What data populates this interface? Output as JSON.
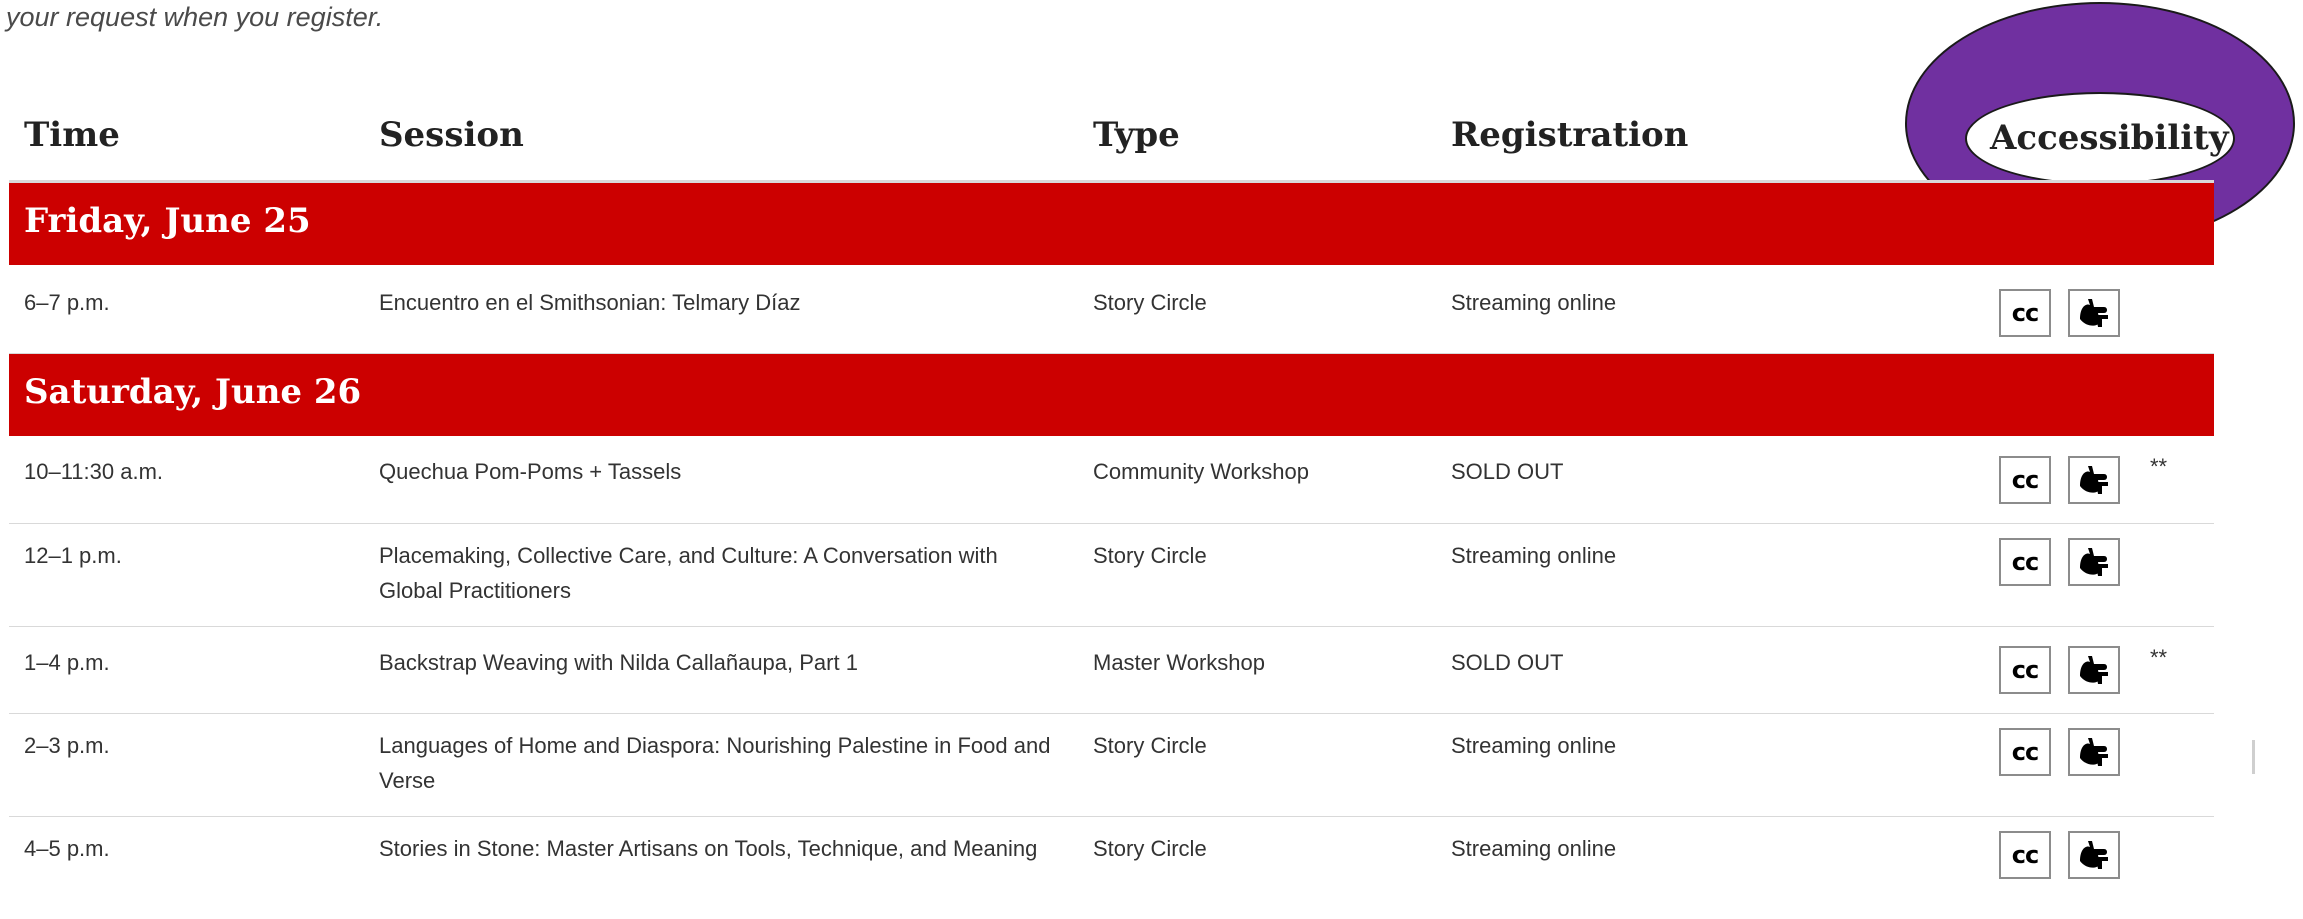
{
  "intro_text": "your request when you register.",
  "headers": {
    "time": "Time",
    "session": "Session",
    "type": "Type",
    "registration": "Registration",
    "accessibility": "Accessibility"
  },
  "days": [
    {
      "label": "Friday, June 25",
      "rows": [
        {
          "time": "6–7 p.m.",
          "session": "Encuentro en el Smithsonian: Telmary Díaz",
          "type": "Story Circle",
          "registration": "Streaming online",
          "note": ""
        }
      ]
    },
    {
      "label": "Saturday, June 26",
      "rows": [
        {
          "time": "10–11:30 a.m.",
          "session": "Quechua Pom-Poms + Tassels",
          "type": "Community Workshop",
          "registration": "SOLD OUT",
          "note": "**"
        },
        {
          "time": "12–1 p.m.",
          "session": "Placemaking, Collective Care, and Culture: A Conversation with Global Practitioners",
          "type": "Story Circle",
          "registration": "Streaming online",
          "note": ""
        },
        {
          "time": "1–4 p.m.",
          "session": "Backstrap Weaving with Nilda Callañaupa, Part 1",
          "type": "Master Workshop",
          "registration": "SOLD OUT",
          "note": "**"
        },
        {
          "time": "2–3 p.m.",
          "session": "Languages of Home and Diaspora: Nourishing Palestine in Food and Verse",
          "type": "Story Circle",
          "registration": "Streaming online",
          "note": ""
        },
        {
          "time": "4–5 p.m.",
          "session": "Stories in Stone: Master Artisans on Tools, Technique, and Meaning",
          "type": "Story Circle",
          "registration": "Streaming online",
          "note": ""
        }
      ]
    }
  ],
  "icons": {
    "cc": "cc",
    "asl": "sign-language-icon"
  },
  "colors": {
    "day_band": "#cc0000",
    "highlight_oval": "#7030a0"
  }
}
